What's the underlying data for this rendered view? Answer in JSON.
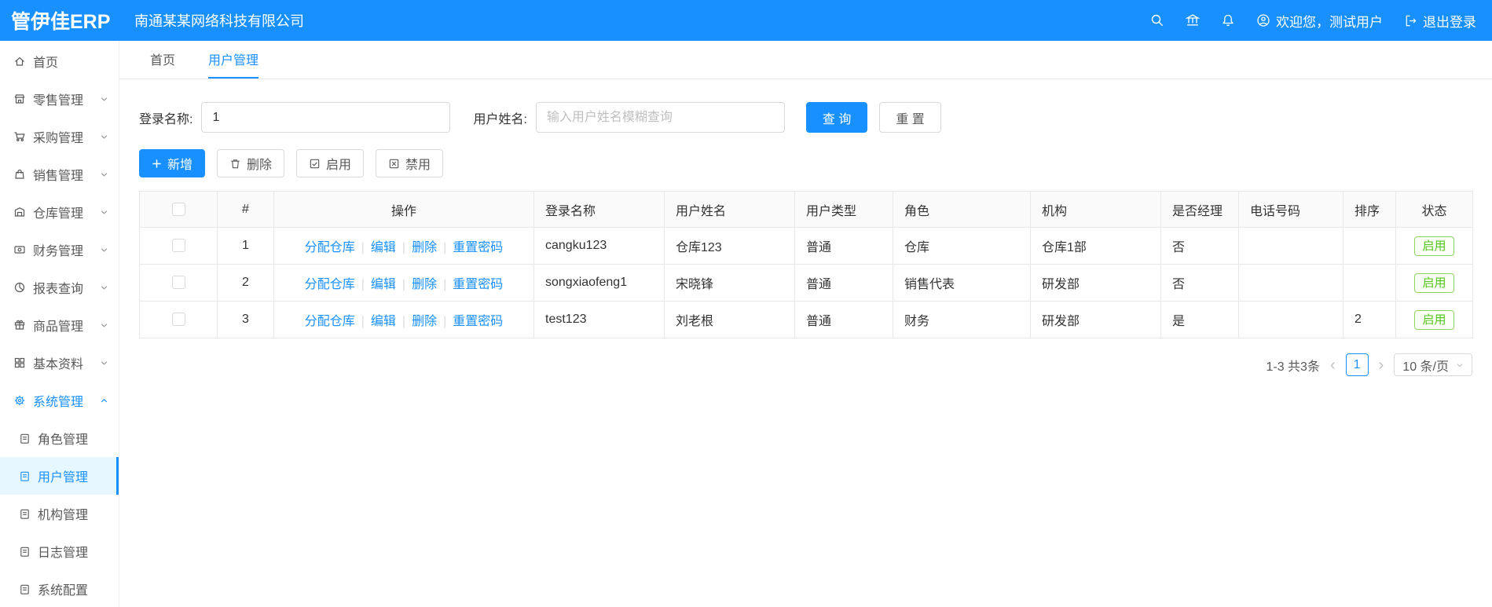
{
  "app": {
    "logo": "管伊佳ERP",
    "company": "南通某某网络科技有限公司"
  },
  "header": {
    "icons": [
      "search",
      "bank",
      "bell"
    ],
    "welcome": "欢迎您，测试用户",
    "logout": "退出登录"
  },
  "colors": {
    "primary": "#1890ff",
    "success": "#52c41a",
    "active_menu_bg": "#e6f7ff"
  },
  "sidebar": {
    "items": [
      {
        "label": "首页",
        "icon": "home"
      },
      {
        "label": "零售管理",
        "icon": "shop",
        "chevron": "down"
      },
      {
        "label": "采购管理",
        "icon": "cart",
        "chevron": "down"
      },
      {
        "label": "销售管理",
        "icon": "bag",
        "chevron": "down"
      },
      {
        "label": "仓库管理",
        "icon": "warehouse",
        "chevron": "down"
      },
      {
        "label": "财务管理",
        "icon": "money",
        "chevron": "down"
      },
      {
        "label": "报表查询",
        "icon": "pie-chart",
        "chevron": "down"
      },
      {
        "label": "商品管理",
        "icon": "gift",
        "chevron": "down"
      },
      {
        "label": "基本资料",
        "icon": "grid",
        "chevron": "down"
      },
      {
        "label": "系统管理",
        "icon": "gear",
        "chevron": "up",
        "active": true
      }
    ],
    "subitems": [
      {
        "label": "角色管理",
        "icon": "file"
      },
      {
        "label": "用户管理",
        "icon": "file",
        "active": true
      },
      {
        "label": "机构管理",
        "icon": "file"
      },
      {
        "label": "日志管理",
        "icon": "file"
      },
      {
        "label": "系统配置",
        "icon": "file"
      }
    ]
  },
  "tabs": [
    {
      "label": "首页"
    },
    {
      "label": "用户管理",
      "active": true
    }
  ],
  "filters": {
    "login_label": "登录名称:",
    "login_value": "1",
    "name_label": "用户姓名:",
    "name_placeholder": "输入用户姓名模糊查询",
    "query": "查 询",
    "reset": "重 置"
  },
  "toolbar": {
    "add": "新增",
    "delete": "删除",
    "enable": "启用",
    "disable": "禁用"
  },
  "table": {
    "columns": [
      "#",
      "操作",
      "登录名称",
      "用户姓名",
      "用户类型",
      "角色",
      "机构",
      "是否经理",
      "电话号码",
      "排序",
      "状态"
    ],
    "op_labels": [
      "分配仓库",
      "编辑",
      "删除",
      "重置密码"
    ],
    "rows": [
      {
        "index": "1",
        "login": "cangku123",
        "name": "仓库123",
        "type": "普通",
        "role": "仓库",
        "org": "仓库1部",
        "manager": "否",
        "phone": "",
        "sort": "",
        "status": "启用"
      },
      {
        "index": "2",
        "login": "songxiaofeng1",
        "name": "宋晓锋",
        "type": "普通",
        "role": "销售代表",
        "org": "研发部",
        "manager": "否",
        "phone": "",
        "sort": "",
        "status": "启用"
      },
      {
        "index": "3",
        "login": "test123",
        "name": "刘老根",
        "type": "普通",
        "role": "财务",
        "org": "研发部",
        "manager": "是",
        "phone": "",
        "sort": "2",
        "status": "启用"
      }
    ]
  },
  "pagination": {
    "range": "1-3 共3条",
    "page": "1",
    "size": "10 条/页"
  }
}
